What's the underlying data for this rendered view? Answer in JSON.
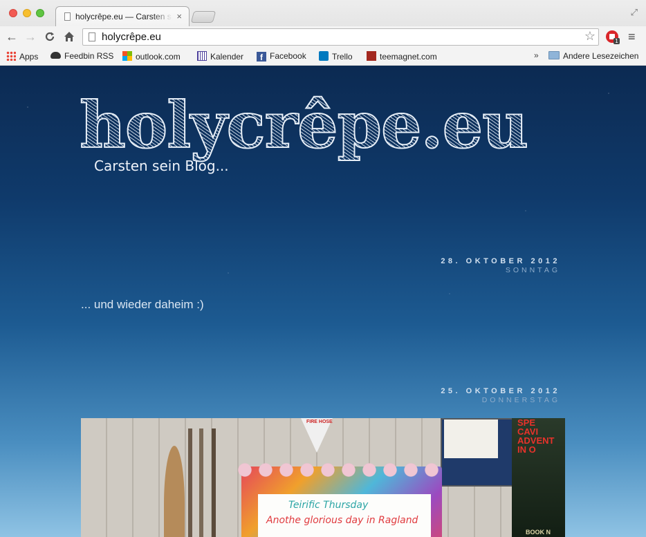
{
  "browser": {
    "tab_title": "holycrêpe.eu — Carsten sein Blog...",
    "tab_close": "×",
    "url": "holycrêpe.eu",
    "nav": {
      "back": "←",
      "forward": "→",
      "reload": "C",
      "home": "⌂"
    },
    "star": "☆",
    "extension_badge": "1",
    "menu": "≡",
    "fullscreen": "⤢"
  },
  "bookmarks": {
    "items": [
      {
        "label": "Apps",
        "icon": "apps-grid-icon"
      },
      {
        "label": "Feedbin RSS",
        "icon": "feedbin-icon"
      },
      {
        "label": "outlook.com",
        "icon": "outlook-icon"
      },
      {
        "label": "Kalender",
        "icon": "calendar-icon"
      },
      {
        "label": "Facebook",
        "icon": "facebook-icon"
      },
      {
        "label": "Trello",
        "icon": "trello-icon"
      },
      {
        "label": "teemagnet.com",
        "icon": "teemagnet-icon"
      }
    ],
    "more": "»",
    "other": "Andere Lesezeichen"
  },
  "site": {
    "logo": "holycrêpe.eu",
    "tagline": "Carsten sein Blog..."
  },
  "posts": [
    {
      "date": "28. OKTOBER 2012",
      "day": "SONNTAG",
      "text": "... und wieder daheim :)"
    },
    {
      "date": "25. OKTOBER 2012",
      "day": "DONNERSTAG"
    }
  ],
  "photo": {
    "whiteboard_line1": "Teirific Thursday",
    "whiteboard_line2": "Anothe glorious day in Ragland",
    "sign": "FIRE HOSE",
    "poster_title": "SPE\nCAVI\nADVENT\nIN O",
    "poster_foot": "BOOK N"
  },
  "colors": {
    "page_top": "#0c2a52",
    "page_bottom": "#8fc3e4",
    "date_text": "#d2e0ef",
    "day_text": "#8eaccb"
  }
}
